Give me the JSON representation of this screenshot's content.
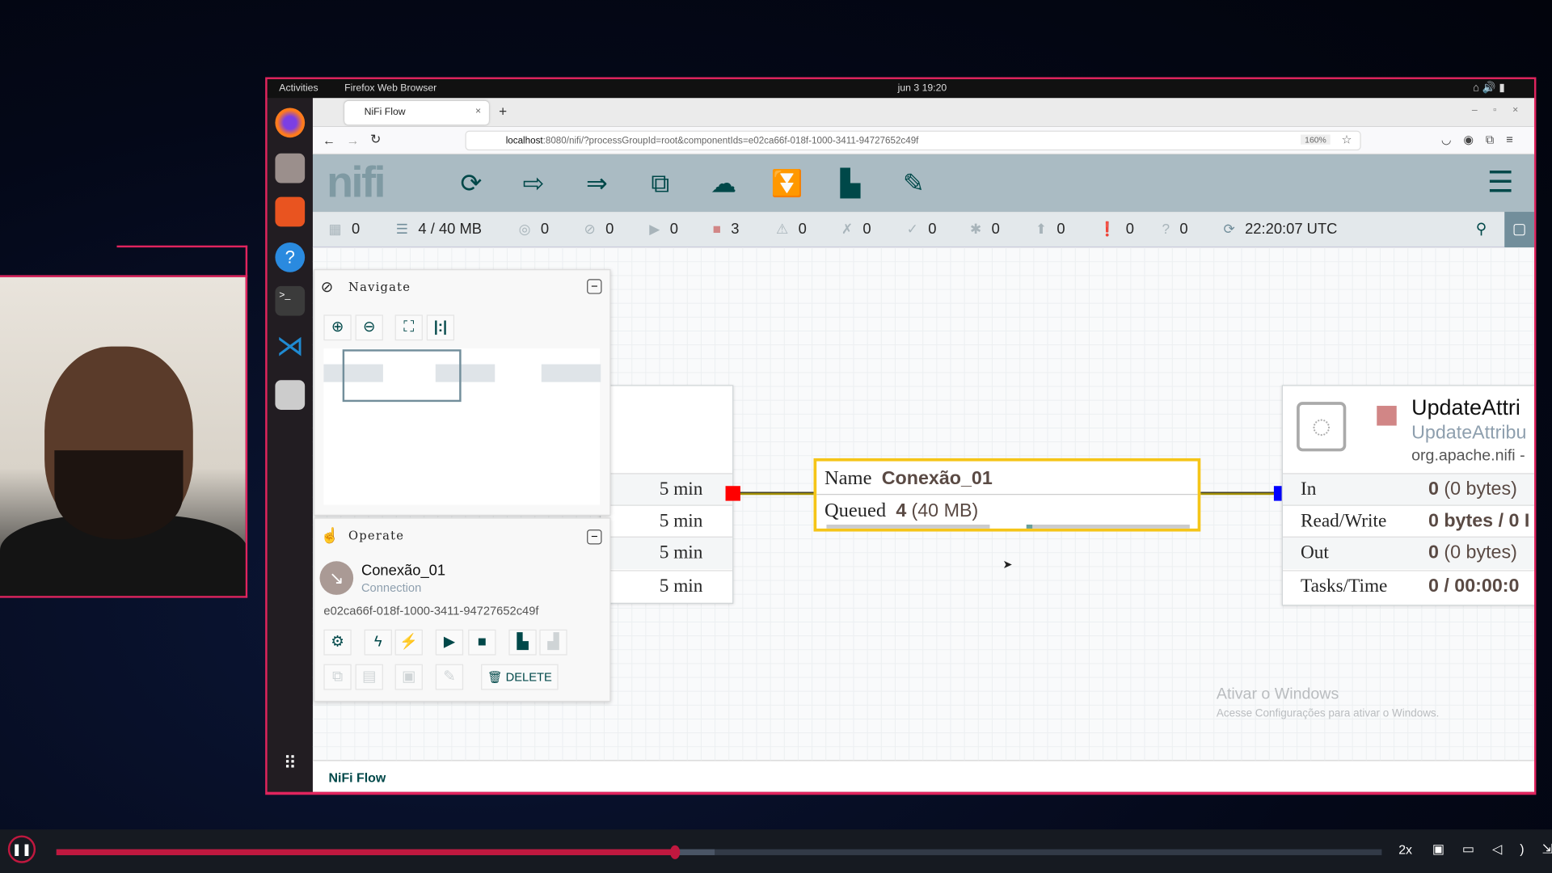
{
  "os": {
    "activities": "Activities",
    "app": "Firefox Web Browser",
    "datetime": "jun 3  19:20"
  },
  "browser": {
    "tab_title": "NiFi Flow",
    "url_host": "localhost",
    "url_rest": ":8080/nifi/?processGroupId=root&componentIds=e02ca66f-018f-1000-3411-94727652c49f",
    "zoom": "160%"
  },
  "nifi": {
    "logo": "nifi",
    "status": [
      {
        "icon": "cluster-icon",
        "value": "0"
      },
      {
        "icon": "queue-icon",
        "value": "4 / 40 MB"
      },
      {
        "icon": "transmitting-icon",
        "value": "0"
      },
      {
        "icon": "not-transmitting-icon",
        "value": "0"
      },
      {
        "icon": "running-icon",
        "value": "0"
      },
      {
        "icon": "stopped-icon",
        "value": "3"
      },
      {
        "icon": "invalid-icon",
        "value": "0"
      },
      {
        "icon": "disabled-icon",
        "value": "0"
      },
      {
        "icon": "up-to-date-icon",
        "value": "0"
      },
      {
        "icon": "locally-modified-icon",
        "value": "0"
      },
      {
        "icon": "stale-icon",
        "value": "0"
      },
      {
        "icon": "sync-failure-icon",
        "value": "0"
      },
      {
        "icon": "unknown-icon",
        "value": "0"
      }
    ],
    "refresh_time": "22:20:07 UTC",
    "navigate": {
      "title": "Navigate"
    },
    "operate": {
      "title": "Operate",
      "name": "Conexão_01",
      "type": "Connection",
      "id": "e02ca66f-018f-1000-3411-94727652c49f",
      "delete": "DELETE"
    },
    "left_node": {
      "rows": [
        "5 min",
        "5 min",
        "5 min",
        "5 min"
      ]
    },
    "connection": {
      "name_label": "Name",
      "name": "Conexão_01",
      "queued_label": "Queued",
      "queued_count": "4",
      "queued_size": "(40 MB)"
    },
    "processor": {
      "name": "UpdateAttri",
      "type": "UpdateAttribu",
      "bundle": "org.apache.nifi -",
      "stats": [
        {
          "label": "In",
          "value": "0",
          "detail": "(0 bytes)"
        },
        {
          "label": "Read/Write",
          "value": "0 bytes / 0 I",
          "detail": ""
        },
        {
          "label": "Out",
          "value": "0",
          "detail": "(0 bytes)"
        },
        {
          "label": "Tasks/Time",
          "value": "0 / 00:00:0",
          "detail": ""
        }
      ]
    },
    "breadcrumb": "NiFi Flow"
  },
  "watermark": {
    "title": "Ativar o Windows",
    "subtitle": "Acesse Configurações para ativar o Windows."
  },
  "video": {
    "progress": 0.467,
    "buffered": 0.497,
    "speed": "2x"
  },
  "colors": {
    "accent": "#e0245e",
    "nifi_teal": "#004849",
    "stopped": "#d18686",
    "selected": "#f5c518"
  }
}
